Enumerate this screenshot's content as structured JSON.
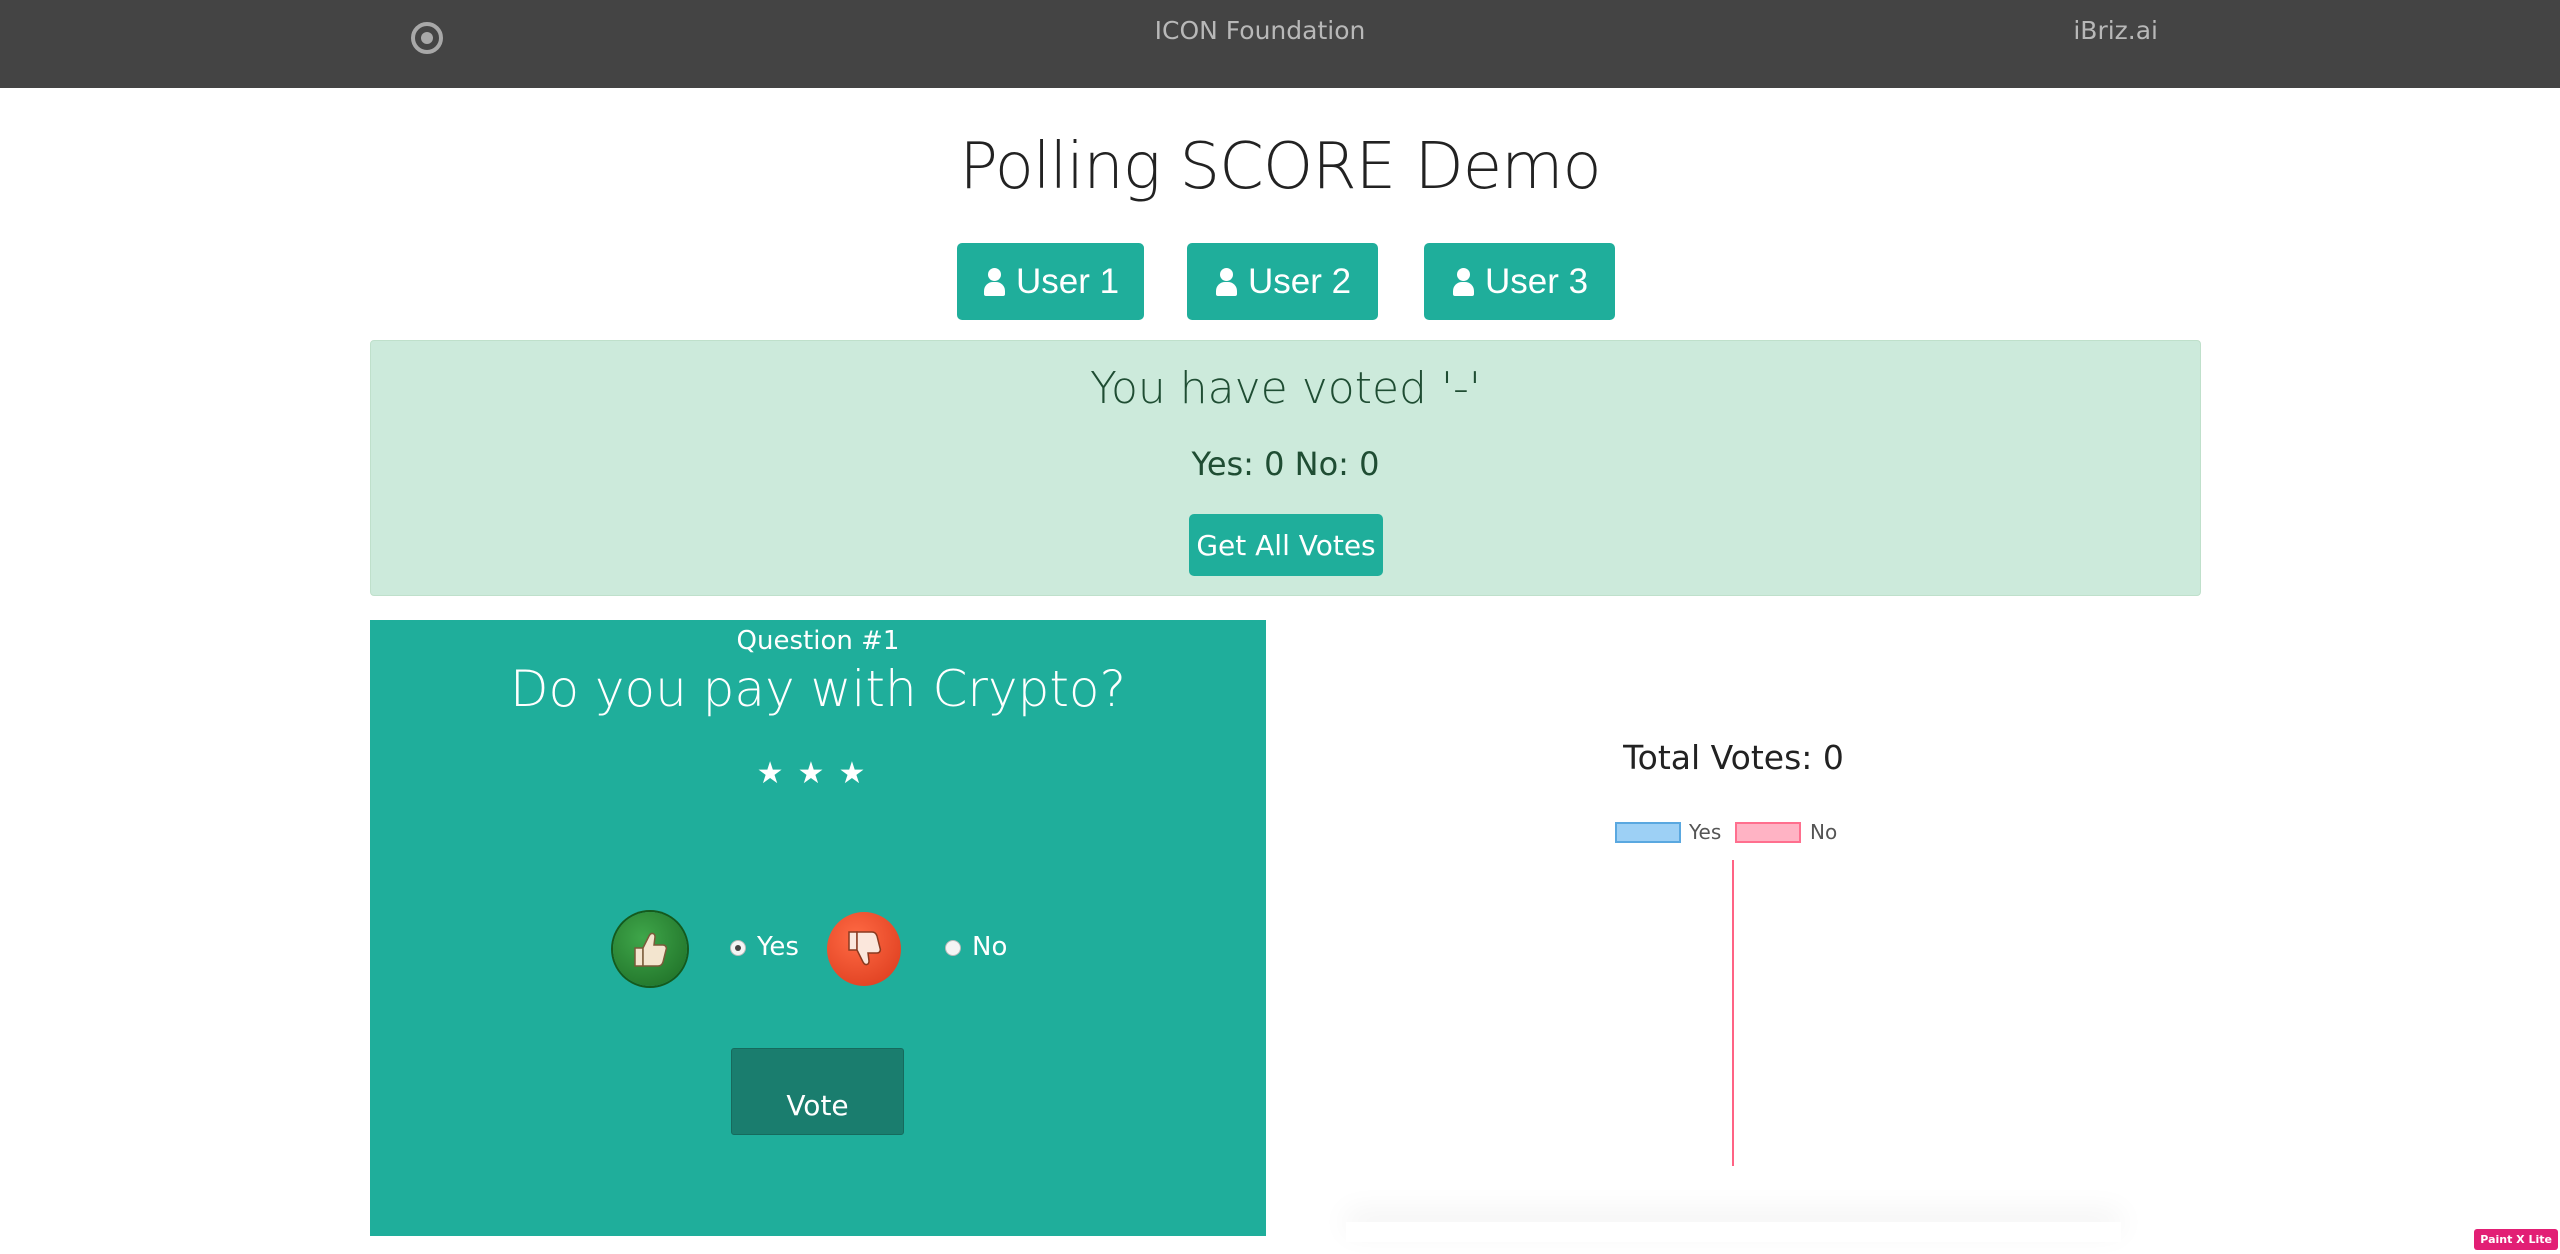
{
  "header": {
    "logo_icon": "target-circle-icon",
    "brand": "ICON Foundation",
    "right_link": "iBriz.ai",
    "bg_color": "#444444"
  },
  "page": {
    "title": "Polling SCORE Demo"
  },
  "users": [
    {
      "label": "User 1",
      "icon": "user-icon"
    },
    {
      "label": "User 2",
      "icon": "user-icon"
    },
    {
      "label": "User 3",
      "icon": "user-icon"
    }
  ],
  "status": {
    "voted_text": "You have voted '-'",
    "counts_text": "Yes: 0 No: 0",
    "get_votes_label": "Get All Votes"
  },
  "question": {
    "number_label": "Question #1",
    "text": "Do you pay with Crypto?",
    "stars": "★★★",
    "options": [
      {
        "label": "Yes",
        "icon": "thumbs-up-icon",
        "selected": true
      },
      {
        "label": "No",
        "icon": "thumbs-down-icon",
        "selected": false
      }
    ],
    "vote_label": "Vote"
  },
  "chart_data": {
    "type": "bar",
    "title": "Total Votes: 0",
    "categories": [],
    "series": [
      {
        "name": "Yes",
        "values": [
          0
        ],
        "color": "#9dd0f5"
      },
      {
        "name": "No",
        "values": [
          0
        ],
        "color": "#ffb3c4"
      }
    ],
    "legend": "top"
  },
  "theme": {
    "accent": "#1fae9b",
    "alert_bg": "#cceadb"
  },
  "extension_badge": "Paint X Lite"
}
